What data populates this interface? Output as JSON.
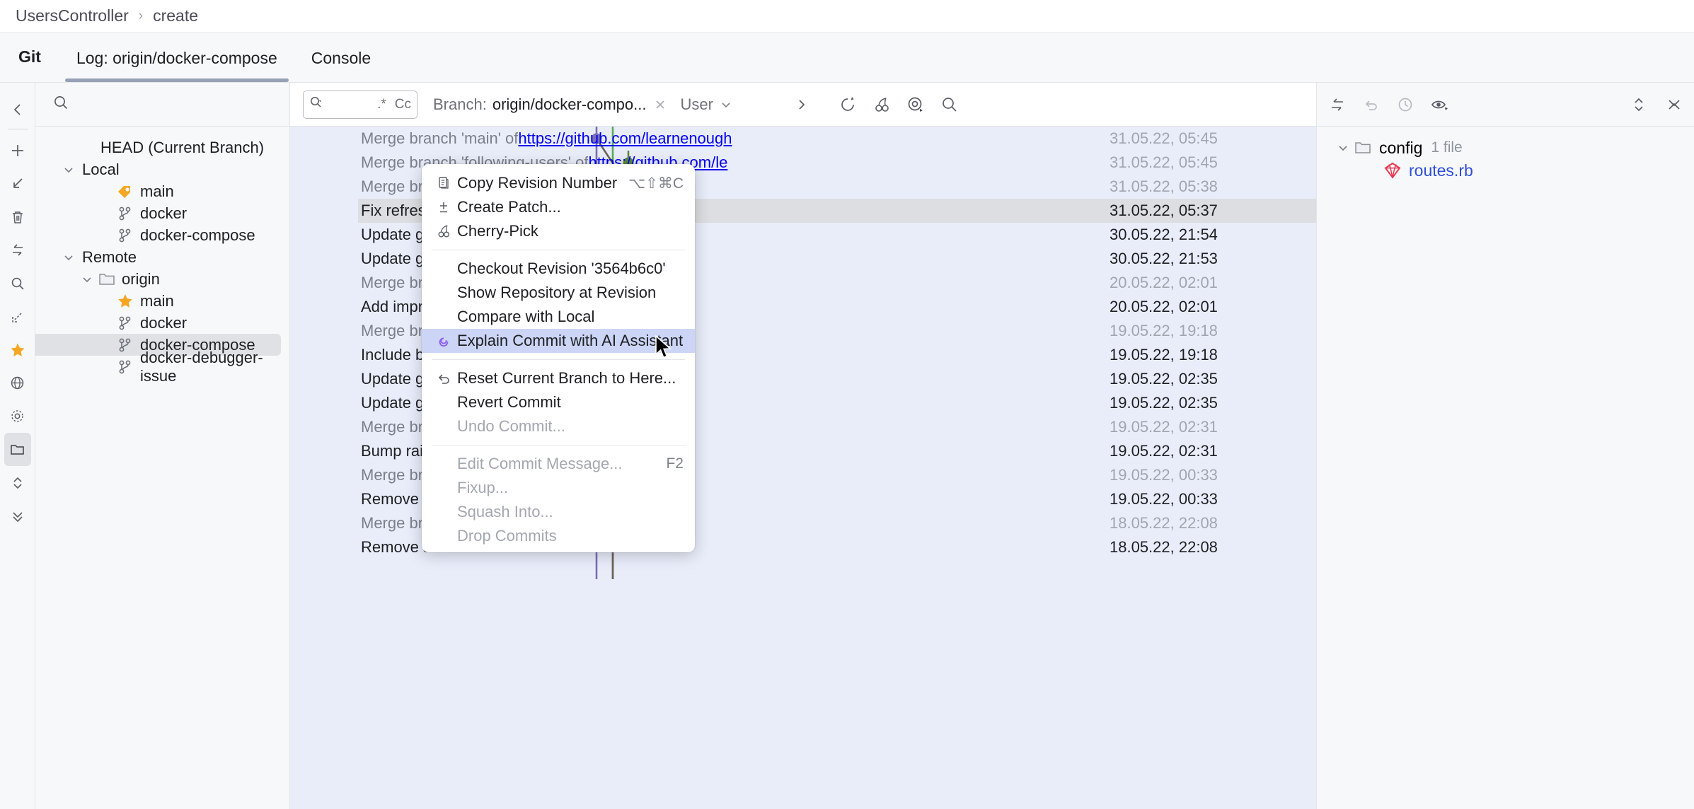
{
  "breadcrumb": {
    "root": "UsersController",
    "sep": "›",
    "leaf": "create"
  },
  "tabbar": {
    "tool_title": "Git",
    "tabs": [
      {
        "label": "Log: origin/docker-compose",
        "active": true
      },
      {
        "label": "Console",
        "active": false
      }
    ]
  },
  "rail": {
    "buttons": [
      "collapse-left-icon",
      "add-icon",
      "pull-icon",
      "delete-icon",
      "swap-icon",
      "search-icon",
      "expand-diagonal-icon",
      "favorite-star-icon",
      "globe-icon",
      "settings-gear-icon",
      "branches-folder-icon",
      "expand-all-icon",
      "collapse-all-icon"
    ]
  },
  "branch_panel": {
    "search_placeholder": "",
    "tree": [
      {
        "label": "HEAD (Current Branch)",
        "indent": 1,
        "icon": "none",
        "chevron": "none"
      },
      {
        "label": "Local",
        "indent": 0,
        "icon": "none",
        "chevron": "down"
      },
      {
        "label": "main",
        "indent": 2,
        "icon": "tag",
        "chevron": "none"
      },
      {
        "label": "docker",
        "indent": 2,
        "icon": "branch",
        "chevron": "none"
      },
      {
        "label": "docker-compose",
        "indent": 2,
        "icon": "branch",
        "chevron": "none"
      },
      {
        "label": "Remote",
        "indent": 0,
        "icon": "none",
        "chevron": "down"
      },
      {
        "label": "origin",
        "indent": 1,
        "icon": "folder",
        "chevron": "down"
      },
      {
        "label": "main",
        "indent": 2,
        "icon": "star",
        "chevron": "none"
      },
      {
        "label": "docker",
        "indent": 2,
        "icon": "branch",
        "chevron": "none"
      },
      {
        "label": "docker-compose",
        "indent": 2,
        "icon": "branch",
        "chevron": "none",
        "selected": true
      },
      {
        "label": "docker-debugger-issue",
        "indent": 2,
        "icon": "branch",
        "chevron": "none"
      }
    ]
  },
  "log_toolbar": {
    "search_value": "",
    "regex_label": ".*",
    "case_label": "Cc",
    "branch_label": "Branch:",
    "branch_value": "origin/docker-compo...",
    "user_label": "User",
    "more_icon": "chevron-right-icon",
    "actions": [
      "refresh-icon",
      "cherry-pick-icon",
      "show-details-icon",
      "find-icon"
    ]
  },
  "commits": [
    {
      "msg": "Merge branch 'main' of ",
      "link": "https://github.com/learnenough",
      "date": "31.05.22, 05:45",
      "muted": true
    },
    {
      "msg": "Merge branch 'following-users' of ",
      "link": "https://github.com/le",
      "date": "31.05.22, 05:45",
      "muted": true
    },
    {
      "msg": "Merge branch 'following-users'",
      "link": "",
      "date": "31.05.22, 05:38",
      "muted": true
    },
    {
      "msg": "Fix refres",
      "link": "",
      "date": "31.05.22, 05:37",
      "muted": false,
      "selected": true
    },
    {
      "msg": "Update ge",
      "link": "",
      "date": "30.05.22, 21:54",
      "muted": false
    },
    {
      "msg": "Update ge",
      "link": "",
      "date": "30.05.22, 21:53",
      "muted": false
    },
    {
      "msg": "Merge bra",
      "link": "",
      "date": "20.05.22, 02:01",
      "muted": true
    },
    {
      "msg": "Add impro",
      "link": "",
      "date": "20.05.22, 02:01",
      "muted": false
    },
    {
      "msg": "Merge bra",
      "link": "",
      "date": "19.05.22, 19:18",
      "muted": true
    },
    {
      "msg": "Include br",
      "link": "",
      "date": "19.05.22, 19:18",
      "muted": false
    },
    {
      "msg": "Update ge",
      "link": "",
      "date": "19.05.22, 02:35",
      "muted": false
    },
    {
      "msg": "Update ge",
      "link": "",
      "date": "19.05.22, 02:35",
      "muted": false
    },
    {
      "msg": "Merge bra",
      "link": "",
      "date": "19.05.22, 02:31",
      "muted": true
    },
    {
      "msg": "Bump rails",
      "link": "",
      "date": "19.05.22, 02:31",
      "muted": false
    },
    {
      "msg": "Merge bra",
      "link": "",
      "date": "19.05.22, 00:33",
      "muted": true
    },
    {
      "msg": "Remove a",
      "link": "",
      "date": "19.05.22, 00:33",
      "muted": false
    },
    {
      "msg": "Merge bra",
      "link": "",
      "date": "18.05.22, 22:08",
      "muted": true
    },
    {
      "msg": "Remove s",
      "link": "",
      "date": "18.05.22, 22:08",
      "muted": false
    }
  ],
  "context_menu": {
    "items": [
      {
        "label": "Copy Revision Number",
        "icon": "copy-icon",
        "shortcut": "⌥⇧⌘C",
        "state": "normal"
      },
      {
        "label": "Create Patch...",
        "icon": "patch-icon",
        "shortcut": "",
        "state": "normal"
      },
      {
        "label": "Cherry-Pick",
        "icon": "cherry-pick-icon",
        "shortcut": "",
        "state": "normal"
      },
      {
        "separator": true
      },
      {
        "label": "Checkout Revision '3564b6c0'",
        "icon": "none",
        "shortcut": "",
        "state": "normal"
      },
      {
        "label": "Show Repository at Revision",
        "icon": "none",
        "shortcut": "",
        "state": "normal"
      },
      {
        "label": "Compare with Local",
        "icon": "none",
        "shortcut": "",
        "state": "normal"
      },
      {
        "label": "Explain Commit with AI Assistant",
        "icon": "ai-assistant-icon",
        "shortcut": "",
        "state": "highlighted"
      },
      {
        "separator": true
      },
      {
        "label": "Reset Current Branch to Here...",
        "icon": "reset-icon",
        "shortcut": "",
        "state": "normal"
      },
      {
        "label": "Revert Commit",
        "icon": "none",
        "shortcut": "",
        "state": "normal"
      },
      {
        "label": "Undo Commit...",
        "icon": "none",
        "shortcut": "",
        "state": "disabled"
      },
      {
        "separator": true
      },
      {
        "label": "Edit Commit Message...",
        "icon": "none",
        "shortcut": "F2",
        "state": "disabled"
      },
      {
        "label": "Fixup...",
        "icon": "none",
        "shortcut": "",
        "state": "disabled"
      },
      {
        "label": "Squash Into...",
        "icon": "none",
        "shortcut": "",
        "state": "disabled"
      },
      {
        "label": "Drop Commits",
        "icon": "none",
        "shortcut": "",
        "state": "disabled"
      }
    ]
  },
  "changes_panel": {
    "actions": [
      "swap-icon",
      "revert-icon",
      "history-icon",
      "show-diff-icon"
    ],
    "right_actions": [
      "expand-collapse-icon",
      "close-icon"
    ],
    "tree": [
      {
        "label": "config",
        "count": "1 file",
        "icon": "folder-icon",
        "chevron": "down",
        "indent": 0
      },
      {
        "label": "routes.rb",
        "count": "",
        "icon": "ruby-icon",
        "chevron": "none",
        "indent": 1
      }
    ]
  },
  "colors": {
    "accent_blue": "#2f4ed8",
    "selection_blue": "#ccd5f5",
    "log_background": "#e9edfa",
    "row_selected": "#dcdee1",
    "star_yellow": "#f5a623",
    "ruby_red": "#e8384f",
    "ai_purple": "#8c5cf0"
  },
  "graph": {
    "lane_x": [
      433,
      456,
      478,
      500
    ],
    "colors": [
      "#7b6fb5",
      "#5aa95a",
      "#6e6157",
      "#5a8a3c",
      "#4a7f4a",
      "#6a4a8a",
      "#7b8fc0"
    ],
    "nodes": [
      {
        "row": 0,
        "lane": 0,
        "color": "#7b6fb5"
      },
      {
        "row": 1,
        "lane": 2,
        "color": "#5a8a3c"
      },
      {
        "row": 2,
        "lane": 0,
        "color": "#7b6fb5"
      },
      {
        "row": 3,
        "lane": 1,
        "color": "#5aa95a"
      },
      {
        "row": 4,
        "lane": 2,
        "color": "#6e6157"
      },
      {
        "row": 5,
        "lane": 3,
        "color": "#5a8a3c"
      },
      {
        "row": 6,
        "lane": 0,
        "color": "#7b6fb5"
      },
      {
        "row": 7,
        "lane": 1,
        "color": "#5a8a3c"
      },
      {
        "row": 8,
        "lane": 0,
        "color": "#7b6fb5"
      },
      {
        "row": 9,
        "lane": 1,
        "color": "#6e6157"
      },
      {
        "row": 10,
        "lane": 0,
        "color": "#7b6fb5"
      },
      {
        "row": 11,
        "lane": 1,
        "color": "#6e6157"
      },
      {
        "row": 12,
        "lane": 0,
        "color": "#7b6fb5"
      },
      {
        "row": 13,
        "lane": 1,
        "color": "#6a4a8a"
      },
      {
        "row": 14,
        "lane": 0,
        "color": "#7b6fb5"
      },
      {
        "row": 15,
        "lane": 1,
        "color": "#4a7f4a"
      },
      {
        "row": 16,
        "lane": 0,
        "color": "#7b6fb5"
      },
      {
        "row": 17,
        "lane": 1,
        "color": "#7b8fc0"
      }
    ]
  }
}
